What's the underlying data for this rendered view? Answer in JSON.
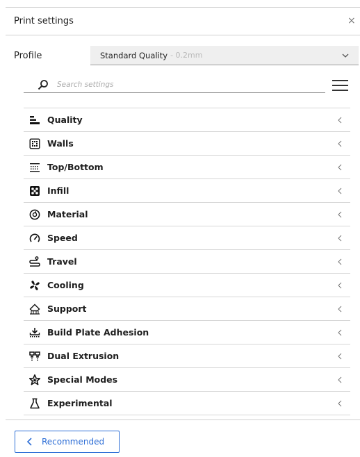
{
  "header": {
    "title": "Print settings",
    "close_glyph": "×",
    "close_icon": "close-icon"
  },
  "profile": {
    "label": "Profile",
    "name": "Standard Quality",
    "sub": "- 0.2mm",
    "dropdown_icon": "chevron-down-icon"
  },
  "search": {
    "placeholder": "Search settings",
    "icon": "search-icon"
  },
  "menu": {
    "icon": "hamburger-menu-icon"
  },
  "categories": [
    {
      "label": "Quality",
      "icon": "quality-icon"
    },
    {
      "label": "Walls",
      "icon": "walls-icon"
    },
    {
      "label": "Top/Bottom",
      "icon": "top-bottom-icon"
    },
    {
      "label": "Infill",
      "icon": "infill-icon"
    },
    {
      "label": "Material",
      "icon": "material-icon"
    },
    {
      "label": "Speed",
      "icon": "speed-icon"
    },
    {
      "label": "Travel",
      "icon": "travel-icon"
    },
    {
      "label": "Cooling",
      "icon": "cooling-icon"
    },
    {
      "label": "Support",
      "icon": "support-icon"
    },
    {
      "label": "Build Plate Adhesion",
      "icon": "build-plate-adhesion-icon"
    },
    {
      "label": "Dual Extrusion",
      "icon": "dual-extrusion-icon"
    },
    {
      "label": "Special Modes",
      "icon": "special-modes-icon"
    },
    {
      "label": "Experimental",
      "icon": "experimental-icon"
    }
  ],
  "footer": {
    "recommended_label": "Recommended",
    "icon": "chevron-left-icon"
  },
  "colors": {
    "accent": "#2f6fd6",
    "text": "#1e1e1e",
    "divider": "#d6d6d6",
    "select_bg": "#efefef",
    "muted": "#b9b9b9"
  }
}
